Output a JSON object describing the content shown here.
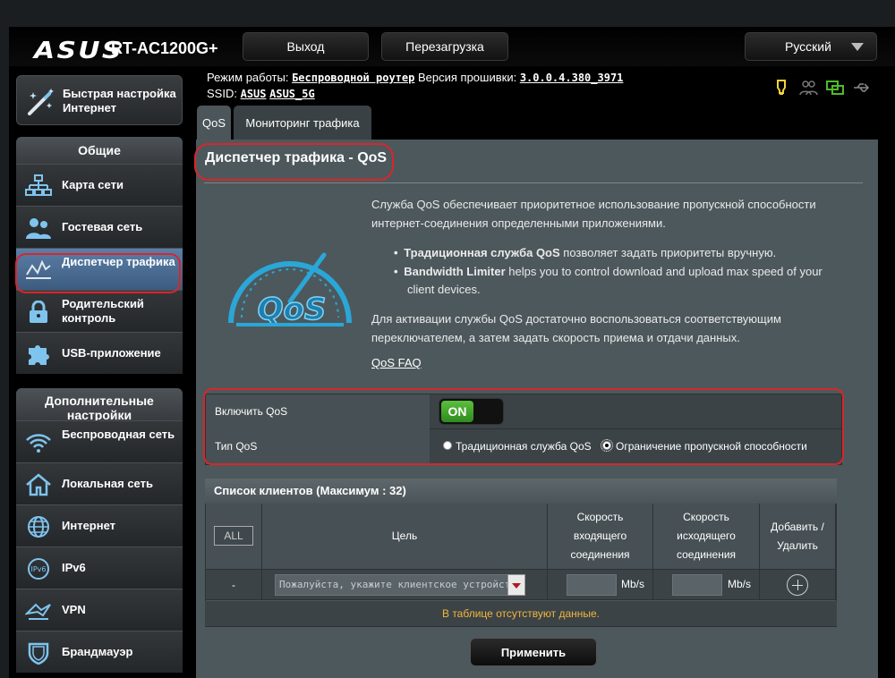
{
  "header": {
    "brand": "ASUS",
    "model": "RT-AC1200G+",
    "logout_label": "Выход",
    "reboot_label": "Перезагрузка",
    "language": "Русский"
  },
  "info": {
    "mode_label": "Режим работы:",
    "mode_value": "Беспроводной роутер",
    "fw_label": "Версия прошивки:",
    "fw_value": "3.0.0.4.380_3971",
    "ssid_label": "SSID:",
    "ssid_1": "ASUS",
    "ssid_2": "ASUS_5G"
  },
  "sidebar": {
    "quick_setup": "Быстрая настройка Интернет",
    "general_header": "Общие",
    "general_items": [
      {
        "label": "Карта сети",
        "icon": "network-map-icon"
      },
      {
        "label": "Гостевая сеть",
        "icon": "guest-network-icon"
      },
      {
        "label": "Диспетчер трафика",
        "icon": "traffic-manager-icon"
      },
      {
        "label": "Родительский контроль",
        "icon": "parental-control-icon"
      },
      {
        "label": "USB-приложение",
        "icon": "usb-app-icon"
      }
    ],
    "advanced_header": "Дополнительные настройки",
    "advanced_items": [
      {
        "label": "Беспроводная сеть",
        "icon": "wireless-icon"
      },
      {
        "label": "Локальная сеть",
        "icon": "lan-icon"
      },
      {
        "label": "Интернет",
        "icon": "internet-icon"
      },
      {
        "label": "IPv6",
        "icon": "ipv6-icon"
      },
      {
        "label": "VPN",
        "icon": "vpn-icon"
      },
      {
        "label": "Брандмауэр",
        "icon": "firewall-icon"
      }
    ]
  },
  "tabs": [
    "QoS",
    "Мониторинг трафика"
  ],
  "main": {
    "title": "Диспетчер трафика - QoS",
    "logo_text": "QoS",
    "desc_1a": "Служба QoS обеспечивает приоритетное использование пропускной способности",
    "desc_1b": "интернет-соединения определенными приложениями.",
    "bullet_1_bold": "Традиционная служба QoS",
    "bullet_1_rest": " позволяет задать приоритеты вручную.",
    "bullet_2_bold": "Bandwidth Limiter",
    "bullet_2_rest": " helps you to control download and upload max speed of your",
    "bullet_2_cont": "client devices.",
    "desc_2a": "Для активации службы QoS достаточно воспользоваться соответствующим",
    "desc_2b": "переключателем, а затем задать скорость приема и отдачи данных.",
    "faq": "QoS FAQ"
  },
  "settings": {
    "enable_label": "Включить QoS",
    "toggle_state": "ON",
    "type_label": "Тип QoS",
    "type_options": [
      "Традиционная служба QoS",
      "Ограничение пропускной способности"
    ],
    "selected_type": "Ограничение пропускной способности"
  },
  "clients": {
    "header": "Список клиентов (Максимум : 32)",
    "all_label": "ALL",
    "col_target": "Цель",
    "col_down_1": "Скорость",
    "col_down_2": "входящего",
    "col_down_3": "соединения",
    "col_up_1": "Скорость",
    "col_up_2": "исходящего",
    "col_up_3": "соединения",
    "col_add_1": "Добавить /",
    "col_add_2": "Удалить",
    "row_dash": "-",
    "placeholder": "Пожалуйста, укажите клиентское устройство",
    "unit": "Mb/s",
    "empty": "В таблице отсутствуют данные."
  },
  "apply_label": "Применить",
  "colors": {
    "accent_red": "#d8262b",
    "toggle_green": "#4aad2f",
    "empty_text": "#f2b53b",
    "active_menu": "#4a6a94",
    "logo_blue": "#2aa7d8"
  }
}
